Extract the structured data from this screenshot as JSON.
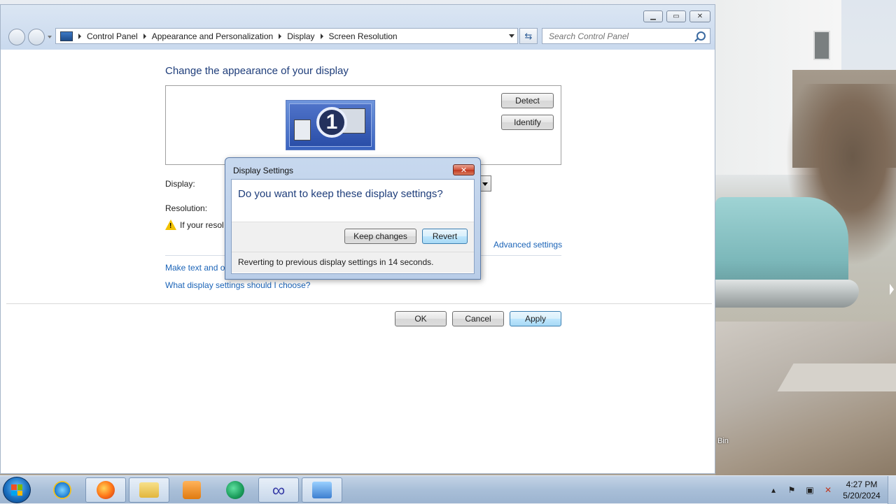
{
  "window": {
    "breadcrumbs": [
      "Control Panel",
      "Appearance and Personalization",
      "Display",
      "Screen Resolution"
    ],
    "search_placeholder": "Search Control Panel"
  },
  "page": {
    "heading": "Change the appearance of your display",
    "monitor_number": "1",
    "detect_label": "Detect",
    "identify_label": "Identify",
    "display_label": "Display:",
    "resolution_label": "Resolution:",
    "warning_text": "If your resol",
    "advanced_link": "Advanced settings",
    "make_text_link": "Make text and ot",
    "what_settings_link": "What display settings should I choose?",
    "ok_label": "OK",
    "cancel_label": "Cancel",
    "apply_label": "Apply"
  },
  "dialog": {
    "title": "Display Settings",
    "question": "Do you want to keep these display settings?",
    "keep_label": "Keep changes",
    "revert_label": "Revert",
    "countdown_text": "Reverting to previous display settings in 14 seconds."
  },
  "desktop": {
    "bin_label": "Bin"
  },
  "taskbar": {
    "apps": [
      "internet-explorer",
      "firefox",
      "file-explorer",
      "media-player",
      "messenger",
      "infinity-app",
      "control-panel"
    ],
    "time": "4:27 PM",
    "date": "5/20/2024"
  },
  "colors": {
    "heading_blue": "#1e3d7a",
    "link_blue": "#1a63b7",
    "close_red": "#c0371f"
  }
}
